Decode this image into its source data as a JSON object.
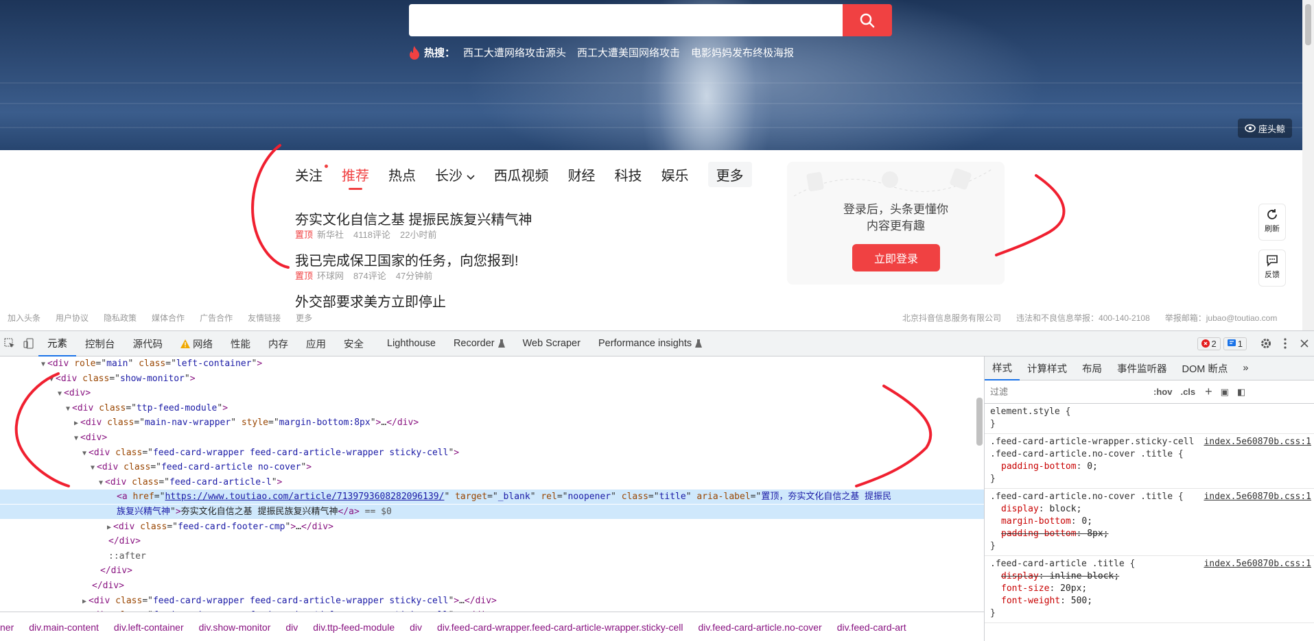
{
  "hero": {
    "search_placeholder": "",
    "hot_label": "热搜：",
    "hot_keywords": [
      "西工大遭网络攻击源头",
      "西工大遭美国网络攻击",
      "电影妈妈发布终极海报"
    ],
    "image_tag": "座头鲸"
  },
  "nav": {
    "items": [
      "关注",
      "推荐",
      "热点",
      "长沙",
      "西瓜视频",
      "财经",
      "科技",
      "娱乐",
      "更多"
    ]
  },
  "articles": [
    {
      "title": "夯实文化自信之基 提振民族复兴精气神",
      "tag": "置顶",
      "source": "新华社",
      "comments": "4118评论",
      "time": "22小时前"
    },
    {
      "title": "我已完成保卫国家的任务，向您报到!",
      "tag": "置顶",
      "source": "环球网",
      "comments": "874评论",
      "time": "47分钟前"
    },
    {
      "title": "外交部要求美方立即停止"
    }
  ],
  "login": {
    "line1": "登录后，头条更懂你",
    "line2": "内容更有趣",
    "button": "立即登录"
  },
  "side": {
    "refresh": "刷新",
    "feedback": "反馈"
  },
  "footer": {
    "left": [
      "加入头条",
      "用户协议",
      "隐私政策",
      "媒体合作",
      "广告合作",
      "友情链接",
      "更多"
    ],
    "right": [
      "北京抖音信息服务有限公司",
      "违法和不良信息举报：400-140-2108",
      "举报邮箱：jubao@toutiao.com"
    ]
  },
  "devtools": {
    "tabs": [
      "元素",
      "控制台",
      "源代码",
      "网络",
      "性能",
      "内存",
      "应用",
      "安全",
      "Lighthouse",
      "Recorder",
      "Web Scraper",
      "Performance insights"
    ],
    "errors": "2",
    "messages": "1",
    "dom": [
      {
        "ind": 5,
        "arrow": "▼",
        "html": "<span class=\"tg\">&lt;div</span> <span class=\"at\">role</span>=\"<span class=\"av\">main</span>\" <span class=\"at\">class</span>=\"<span class=\"av\">left-container</span>\"<span class=\"tg\">&gt;</span>"
      },
      {
        "ind": 6,
        "arrow": "▼",
        "html": "<span class=\"tg\">&lt;div</span> <span class=\"at\">class</span>=\"<span class=\"av\">show-monitor</span>\"<span class=\"tg\">&gt;</span>"
      },
      {
        "ind": 7,
        "arrow": "▼",
        "html": "<span class=\"tg\">&lt;div&gt;</span>"
      },
      {
        "ind": 8,
        "arrow": "▼",
        "html": "<span class=\"tg\">&lt;div</span> <span class=\"at\">class</span>=\"<span class=\"av\">ttp-feed-module</span>\"<span class=\"tg\">&gt;</span>"
      },
      {
        "ind": 9,
        "arrow": "▶",
        "html": "<span class=\"tg\">&lt;div</span> <span class=\"at\">class</span>=\"<span class=\"av\">main-nav-wrapper</span>\" <span class=\"at\">style</span>=\"<span class=\"av\">margin-bottom:8px</span>\"<span class=\"tg\">&gt;</span>…<span class=\"tg\">&lt;/div&gt;</span>"
      },
      {
        "ind": 9,
        "arrow": "▼",
        "html": "<span class=\"tg\">&lt;div&gt;</span>"
      },
      {
        "ind": 10,
        "arrow": "▼",
        "html": "<span class=\"tg\">&lt;div</span> <span class=\"at\">class</span>=\"<span class=\"av\">feed-card-wrapper feed-card-article-wrapper sticky-cell</span>\"<span class=\"tg\">&gt;</span>"
      },
      {
        "ind": 11,
        "arrow": "▼",
        "html": "<span class=\"tg\">&lt;div</span> <span class=\"at\">class</span>=\"<span class=\"av\">feed-card-article no-cover</span>\"<span class=\"tg\">&gt;</span>"
      },
      {
        "ind": 12,
        "arrow": "▼",
        "html": "<span class=\"tg\">&lt;div</span> <span class=\"at\">class</span>=\"<span class=\"av\">feed-card-article-l</span>\"<span class=\"tg\">&gt;</span>"
      },
      {
        "ind": 13,
        "arrow": "",
        "sel": true,
        "html": "<span class=\"tg\">&lt;a</span> <span class=\"at\">href</span>=\"<span class=\"av\" style=\"text-decoration:underline\">https://www.toutiao.com/article/7139793608282096139/</span>\" <span class=\"at\">target</span>=\"<span class=\"av\">_blank</span>\" <span class=\"at\">rel</span>=\"<span class=\"av\">noopener</span>\" <span class=\"at\">class</span>=\"<span class=\"av\">title</span>\" <span class=\"at\">aria-label</span>=\"<span class=\"av\">置顶，夯实文化自信之基 提振民</span>"
      },
      {
        "ind": 13,
        "arrow": "",
        "sel": true,
        "html": "<span class=\"av\">族复兴精气神</span>\"<span class=\"tg\">&gt;</span><span class=\"tx\">夯实文化自信之基 提振民族复兴精气神</span><span class=\"tg\">&lt;/a&gt;</span> <span class=\"pc\">== $0</span>"
      },
      {
        "ind": 13,
        "arrow": "▶",
        "html": "<span class=\"tg\">&lt;div</span> <span class=\"at\">class</span>=\"<span class=\"av\">feed-card-footer-cmp</span>\"<span class=\"tg\">&gt;</span>…<span class=\"tg\">&lt;/div&gt;</span>"
      },
      {
        "ind": 12,
        "arrow": "",
        "html": "<span class=\"tg\">&lt;/div&gt;</span>"
      },
      {
        "ind": 12,
        "arrow": "",
        "html": "<span class=\"pc\">::after</span>"
      },
      {
        "ind": 11,
        "arrow": "",
        "html": "<span class=\"tg\">&lt;/div&gt;</span>"
      },
      {
        "ind": 10,
        "arrow": "",
        "html": "<span class=\"tg\">&lt;/div&gt;</span>"
      },
      {
        "ind": 10,
        "arrow": "▶",
        "html": "<span class=\"tg\">&lt;div</span> <span class=\"at\">class</span>=\"<span class=\"av\">feed-card-wrapper feed-card-article-wrapper sticky-cell</span>\"<span class=\"tg\">&gt;</span>…<span class=\"tg\">&lt;/div&gt;</span>"
      },
      {
        "ind": 10,
        "arrow": "▶",
        "html": "<span class=\"tg\">&lt;div</span> <span class=\"at\">class</span>=\"<span class=\"av\">feed-card-wrapper feed-card-article-wrapper sticky-cell</span>\"<span class=\"tg\">&gt;</span>…<span class=\"tg\">&lt;/div&gt;</span>"
      }
    ],
    "breadcrumbs": [
      "ner",
      "div.main-content",
      "div.left-container",
      "div.show-monitor",
      "div",
      "div.ttp-feed-module",
      "div",
      "div.feed-card-wrapper.feed-card-article-wrapper.sticky-cell",
      "div.feed-card-article.no-cover",
      "div.feed-card-art"
    ],
    "styles_tabs": [
      "样式",
      "计算样式",
      "布局",
      "事件监听器",
      "DOM 断点"
    ],
    "filter_placeholder": "过滤",
    "filter_tools": [
      ":hov",
      ".cls"
    ],
    "rules": [
      {
        "selector": "element.style {",
        "source": "",
        "props": []
      },
      {
        "selector": ".feed-card-article-wrapper.sticky-cell .feed-card-article.no-cover .title {",
        "source": "index.5e60870b.css:1",
        "props": [
          {
            "name": "padding-bottom",
            "value": "0;",
            "strike": false
          }
        ]
      },
      {
        "selector": ".feed-card-article.no-cover .title {",
        "source": "index.5e60870b.css:1",
        "props": [
          {
            "name": "display",
            "value": "block;",
            "strike": false
          },
          {
            "name": "margin-bottom",
            "value": "0;",
            "strike": false
          },
          {
            "name": "padding-bottom",
            "value": "8px;",
            "strike": true
          }
        ]
      },
      {
        "selector": ".feed-card-article .title {",
        "source": "index.5e60870b.css:1",
        "props": [
          {
            "name": "display",
            "value": "inline-block;",
            "strike": true
          },
          {
            "name": "font-size",
            "value": "20px;",
            "strike": false
          },
          {
            "name": "font-weight",
            "value": "500;",
            "strike": false
          }
        ]
      }
    ]
  }
}
